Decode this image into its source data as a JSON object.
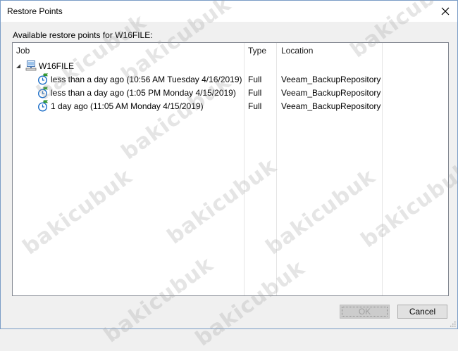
{
  "window": {
    "title": "Restore Points"
  },
  "caption": "Available restore points for W16FILE:",
  "columns": {
    "job": "Job",
    "type": "Type",
    "location": "Location"
  },
  "tree": {
    "vm": {
      "name": "W16FILE",
      "icon": "vm-server-icon",
      "expanded": true
    },
    "points": [
      {
        "label": "less than a day ago (10:56 AM Tuesday 4/16/2019)",
        "type": "Full",
        "location": "Veeam_BackupRepository",
        "icon": "restore-point-clock-icon"
      },
      {
        "label": "less than a day ago (1:05 PM Monday 4/15/2019)",
        "type": "Full",
        "location": "Veeam_BackupRepository",
        "icon": "restore-point-clock-icon"
      },
      {
        "label": "1 day ago (11:05 AM Monday 4/15/2019)",
        "type": "Full",
        "location": "Veeam_BackupRepository",
        "icon": "restore-point-clock-icon"
      }
    ]
  },
  "buttons": {
    "ok": "OK",
    "cancel": "Cancel"
  },
  "watermark": "bakicubuk",
  "colors": {
    "accent": "#2a8c2a",
    "clock": "#1e6fc8",
    "border": "#828790"
  }
}
